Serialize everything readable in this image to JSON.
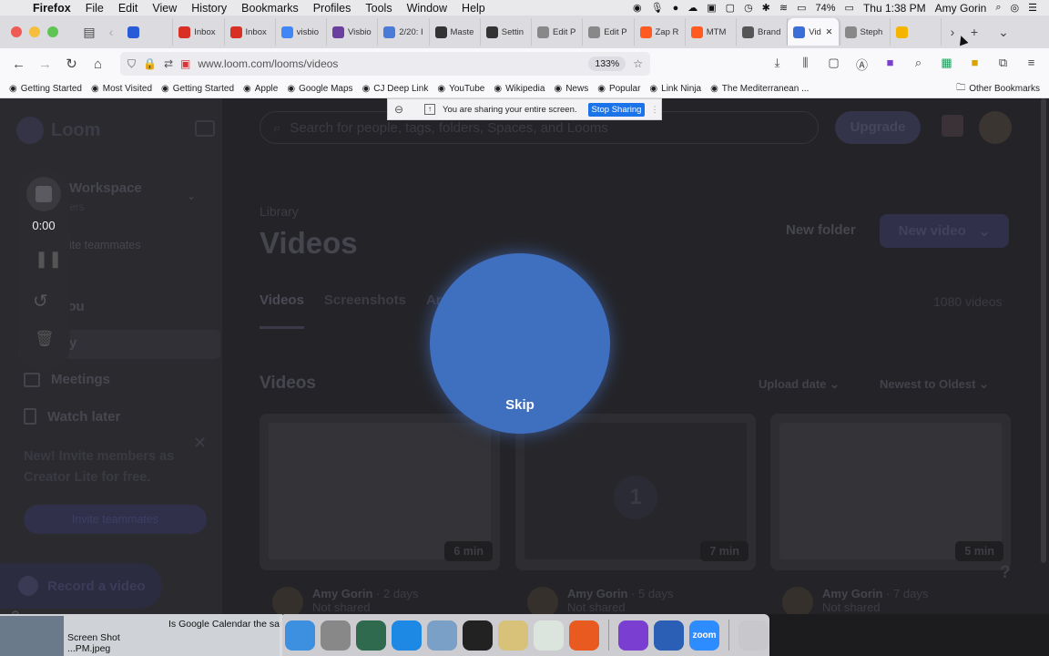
{
  "menubar": {
    "app": "Firefox",
    "items": [
      "File",
      "Edit",
      "View",
      "History",
      "Bookmarks",
      "Profiles",
      "Tools",
      "Window",
      "Help"
    ],
    "battery": "74%",
    "clock": "Thu 1:38 PM",
    "user": "Amy Gorin"
  },
  "tabs": [
    {
      "label": "",
      "color": "#2a5bd7",
      "icon": "loom-square-icon"
    },
    {
      "label": "Inbox",
      "color": "#d93025",
      "icon": "gmail-icon"
    },
    {
      "label": "Inbox",
      "color": "#d93025",
      "icon": "gmail-icon"
    },
    {
      "label": "visbio",
      "color": "#4285f4",
      "icon": "google-icon"
    },
    {
      "label": "Visbio",
      "color": "#6b3fa0",
      "icon": "visbio-icon"
    },
    {
      "label": "2/20: I",
      "color": "#4a7bd9",
      "icon": "doc-icon"
    },
    {
      "label": "Maste",
      "color": "#333333",
      "icon": "typewriter-icon"
    },
    {
      "label": "Settin",
      "color": "#333333",
      "icon": "typewriter-icon"
    },
    {
      "label": "Edit P",
      "color": "#888888",
      "icon": "wp-icon"
    },
    {
      "label": "Edit P",
      "color": "#888888",
      "icon": "wp-icon"
    },
    {
      "label": "Zap R",
      "color": "#ff5a1f",
      "icon": "zapier-icon"
    },
    {
      "label": "MTM",
      "color": "#ff5a1f",
      "icon": "mtm-icon"
    },
    {
      "label": "Brand",
      "color": "#555555",
      "icon": "dot-icon"
    },
    {
      "label": "Vid",
      "color": "#3a6fd8",
      "icon": "loom-icon",
      "active": true
    },
    {
      "label": "Steph",
      "color": "#888888",
      "icon": "wp-icon"
    },
    {
      "label": "",
      "color": "#f4b400",
      "icon": "google-icon"
    }
  ],
  "url": "www.loom.com/looms/videos",
  "zoom": "133%",
  "bookmarks": [
    {
      "label": "Getting Started",
      "icon": "firefox-icon"
    },
    {
      "label": "Most Visited",
      "icon": "gear-icon"
    },
    {
      "label": "Getting Started",
      "icon": "firefox-icon"
    },
    {
      "label": "Apple",
      "icon": "apple-icon"
    },
    {
      "label": "Google Maps",
      "icon": "map-icon"
    },
    {
      "label": "CJ Deep Link",
      "icon": "globe-icon"
    },
    {
      "label": "YouTube",
      "icon": "youtube-icon"
    },
    {
      "label": "Wikipedia",
      "icon": "wikipedia-icon"
    },
    {
      "label": "News",
      "icon": "folder-icon"
    },
    {
      "label": "Popular",
      "icon": "folder-icon"
    },
    {
      "label": "Link Ninja",
      "icon": "globe-icon"
    },
    {
      "label": "The Mediterranean ...",
      "icon": "site-icon"
    }
  ],
  "other_bookmarks": "Other Bookmarks",
  "share_banner": {
    "text": "You are sharing your entire screen.",
    "stop_label": "Stop Sharing"
  },
  "loom": {
    "logo": "Loom",
    "search_placeholder": "Search for people, tags, folders, Spaces, and Looms",
    "upgrade": "Upgrade",
    "workspace_title": "Workspace",
    "workspace_sub": "ers",
    "invite_link": "ite teammates",
    "nav": {
      "for_you": "r you",
      "library": "rary",
      "meetings": "Meetings",
      "watch_later": "Watch later"
    },
    "promo_text": "New! Invite members as Creator Lite for free.",
    "promo_button": "Invite teammates",
    "record_button": "Record a video",
    "library_label": "Library",
    "title": "Videos",
    "new_folder": "New folder",
    "new_video": "New video",
    "tabs": [
      "Videos",
      "Screenshots",
      "Arch"
    ],
    "video_count": "1080 videos",
    "section": "Videos",
    "sort_by": "Upload date",
    "sort_order": "Newest to Oldest",
    "cards": [
      {
        "duration": "6 min",
        "author": "Amy Gorin",
        "when": "2 days",
        "status": "Not shared"
      },
      {
        "duration": "7 min",
        "author": "Amy Gorin",
        "when": "5 days",
        "status": "Not shared",
        "badge": "1"
      },
      {
        "duration": "5 min",
        "author": "Amy Gorin",
        "when": "7 days",
        "status": "Not shared"
      }
    ]
  },
  "recorder": {
    "time": "0:00"
  },
  "countdown": {
    "skip": "Skip"
  },
  "desktop": {
    "file_label_1": "Screen Shot",
    "file_label_2": "...PM.jpeg",
    "notification": "Is Google Calendar the sar"
  },
  "dock_apps": [
    {
      "name": "finder",
      "color": "#3d8fe0"
    },
    {
      "name": "system-preferences",
      "color": "#888888"
    },
    {
      "name": "time-machine",
      "color": "#2f6a4f"
    },
    {
      "name": "safari",
      "color": "#1e88e5"
    },
    {
      "name": "preview",
      "color": "#7aa0c8"
    },
    {
      "name": "terminal",
      "color": "#222222"
    },
    {
      "name": "notes",
      "color": "#d8c27a"
    },
    {
      "name": "chrome",
      "color": "#dbe4dd"
    },
    {
      "name": "remote-desktop",
      "color": "#e85a1f"
    },
    {
      "name": "firefox",
      "color": "#7a3fd0"
    },
    {
      "name": "word",
      "color": "#2b5fb5"
    },
    {
      "name": "zoom",
      "color": "#2d8cff",
      "label": "zoom"
    },
    {
      "name": "trash",
      "color": "#c8c8cc"
    }
  ]
}
